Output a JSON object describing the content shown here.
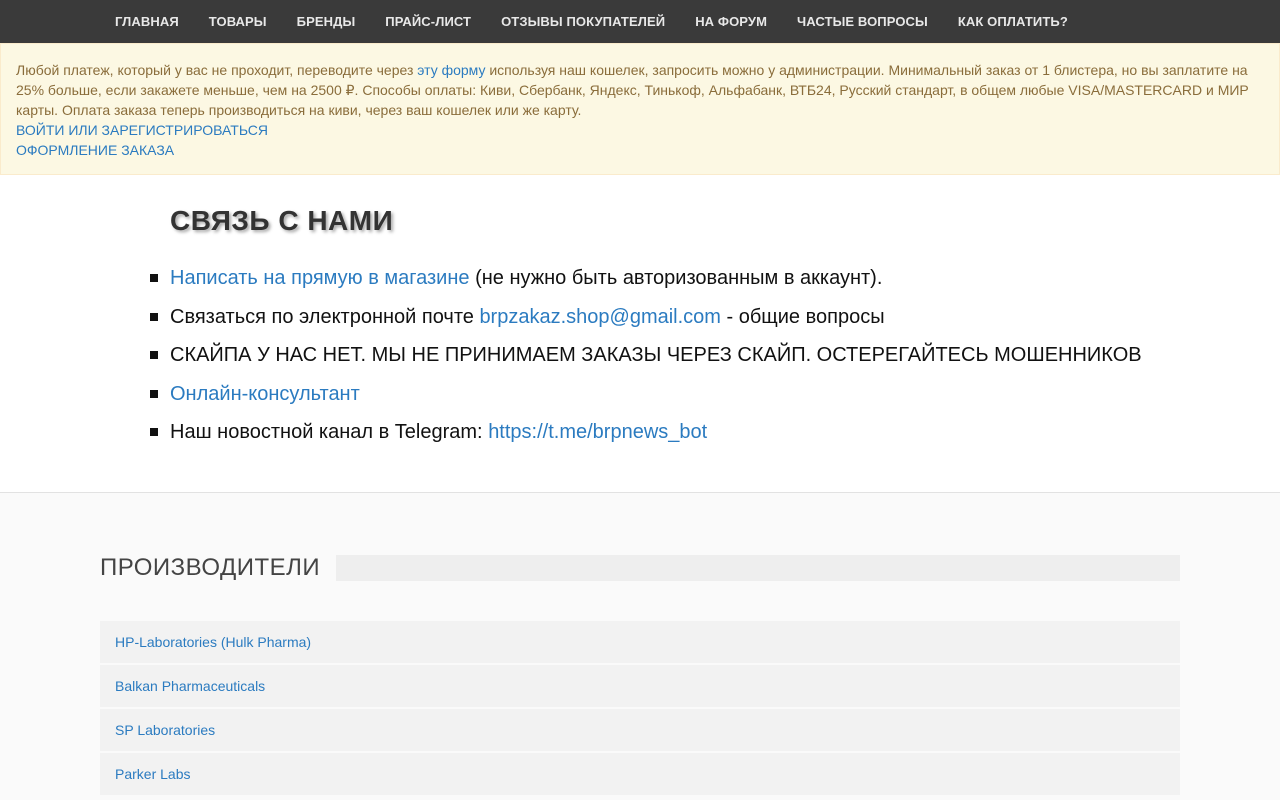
{
  "nav": {
    "items": [
      "ГЛАВНАЯ",
      "ТОВАРЫ",
      "БРЕНДЫ",
      "ПРАЙС-ЛИСТ",
      "ОТЗЫВЫ ПОКУПАТЕЛЕЙ",
      "НА ФОРУМ",
      "ЧАСТЫЕ ВОПРОСЫ",
      "КАК ОПЛАТИТЬ?"
    ]
  },
  "notice": {
    "text_before": "Любой платеж, который у вас не проходит, переводите через ",
    "form_link": "эту форму",
    "text_after": " используя наш кошелек, запросить можно у администрации. Минимальный заказ от 1 блистера, но вы заплатите на 25% больше, если закажете меньше, чем на 2500 ₽. Способы оплаты: Киви, Сбербанк, Яндекс, Тинькоф, Альфабанк, ВТБ24, Русский стандарт, в общем любые VISA/MASTERCARD и МИР карты. Оплата заказа теперь производиться на киви, через ваш кошелек или же карту.",
    "login_link": "ВОЙТИ или ЗАРЕГИСТРИРОВАТЬСЯ",
    "order_link": "ОФОРМЛЕНИЕ ЗАКАЗА"
  },
  "contact": {
    "title": "СВЯЗЬ С НАМИ",
    "item1_link": "Написать на прямую в магазине",
    "item1_text": " (не нужно быть авторизованным в аккаунт).",
    "item2_text": "Связаться по электронной почте ",
    "item2_link": "brpzakaz.shop@gmail.com",
    "item2_after": " - общие вопросы",
    "item3_text": "СКАЙПА У НАС НЕТ. МЫ НЕ ПРИНИМАЕМ ЗАКАЗЫ ЧЕРЕЗ СКАЙП. ОСТЕРЕГАЙТЕСЬ МОШЕННИКОВ",
    "item4_link": "Онлайн-консультант",
    "item5_text": "Наш новостной канал в Telegram: ",
    "item5_link": "https://t.me/brpnews_bot"
  },
  "makers": {
    "title": "ПРОИЗВОДИТЕЛИ",
    "items": [
      "HP-Laboratories (Hulk Pharma)",
      "Balkan Pharmaceuticals",
      "SP Laboratories",
      "Parker Labs"
    ]
  },
  "colors": {
    "nav_bg": "#3a3a3a",
    "notice_bg": "#fcf8e3",
    "notice_text": "#8a6d3b",
    "link": "#2b7bc0"
  }
}
